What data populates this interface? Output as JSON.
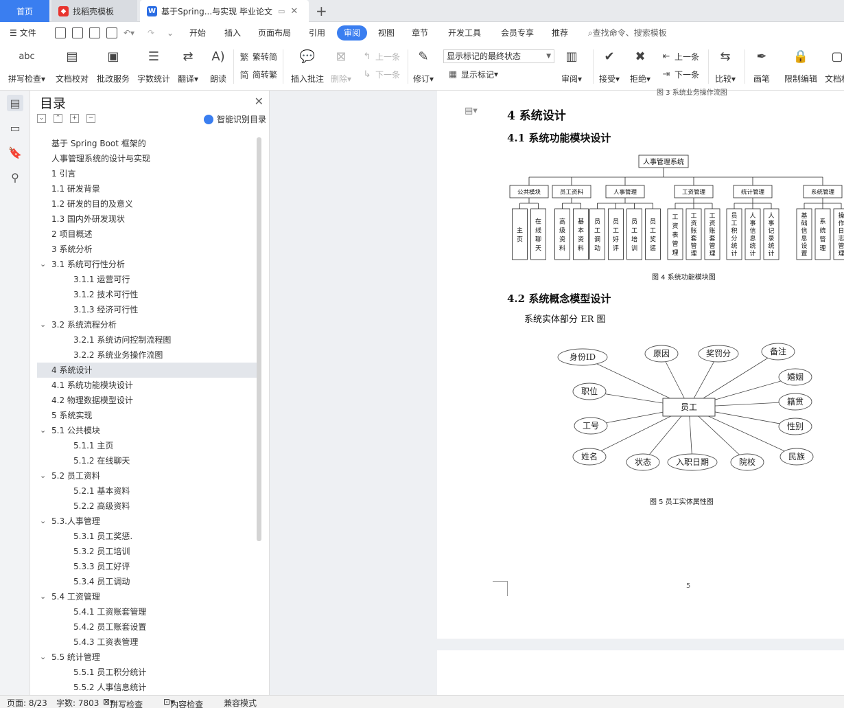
{
  "tabs": {
    "home": "首页",
    "template": "找稻壳模板",
    "document": "基于Spring...与实现 毕业论文"
  },
  "menu": {
    "file": "文件",
    "items": [
      "开始",
      "插入",
      "页面布局",
      "引用",
      "审阅",
      "视图",
      "章节",
      "开发工具",
      "会员专享",
      "推荐"
    ],
    "active": "审阅",
    "search": "查找命令、搜索模板"
  },
  "ribbon": {
    "spell": "拼写检查",
    "proofread": "文档校对",
    "review_service": "批改服务",
    "word_count": "字数统计",
    "translate": "翻译",
    "read_aloud": "朗读",
    "to_simplified": "繁转简",
    "to_traditional": "简转繁",
    "insert_comment": "插入批注",
    "delete": "删除",
    "prev_comment": "上一条",
    "next_comment": "下一条",
    "track_changes": "修订",
    "markup_state": "显示标记的最终状态",
    "show_markup": "显示标记",
    "review": "审阅",
    "accept": "接受",
    "reject": "拒绝",
    "prev": "上一条",
    "next": "下一条",
    "compare": "比较",
    "ink": "画笔",
    "restrict": "限制编辑",
    "doc_rights": "文档权"
  },
  "toc": {
    "title": "目录",
    "smart": "智能识别目录",
    "items": [
      {
        "text": "基于 Spring Boot 框架的",
        "level": 0
      },
      {
        "text": "人事管理系统的设计与实现",
        "level": 0
      },
      {
        "text": "1 引言",
        "level": 0
      },
      {
        "text": "1.1 研发背景",
        "level": 0
      },
      {
        "text": "1.2 研发的目的及意义",
        "level": 0
      },
      {
        "text": "1.3 国内外研发现状",
        "level": 0
      },
      {
        "text": "2 项目概述",
        "level": 0
      },
      {
        "text": "3 系统分析",
        "level": 0
      },
      {
        "text": "3.1 系统可行性分析",
        "level": 0,
        "chev": true
      },
      {
        "text": "3.1.1 运营可行",
        "level": 1
      },
      {
        "text": "3.1.2 技术可行性",
        "level": 1
      },
      {
        "text": "3.1.3 经济可行性",
        "level": 1
      },
      {
        "text": "3.2 系统流程分析",
        "level": 0,
        "chev": true
      },
      {
        "text": "3.2.1 系统访问控制流程图",
        "level": 1
      },
      {
        "text": "3.2.2 系统业务操作流图",
        "level": 1
      },
      {
        "text": "4 系统设计",
        "level": 0,
        "highlight": true
      },
      {
        "text": "4.1 系统功能模块设计",
        "level": 0
      },
      {
        "text": "4.2 物理数据模型设计",
        "level": 0
      },
      {
        "text": "5 系统实现",
        "level": 0
      },
      {
        "text": "5.1  公共模块",
        "level": 0,
        "chev": true
      },
      {
        "text": "5.1.1 主页",
        "level": 1
      },
      {
        "text": "5.1.2 在线聊天",
        "level": 1
      },
      {
        "text": "5.2  员工资料",
        "level": 0,
        "chev": true
      },
      {
        "text": "5.2.1 基本资料",
        "level": 1
      },
      {
        "text": "5.2.2  高级资料",
        "level": 1
      },
      {
        "text": "5.3.人事管理",
        "level": 0,
        "chev": true
      },
      {
        "text": "5.3.1 员工奖惩.",
        "level": 1
      },
      {
        "text": "5.3.2 员工培训",
        "level": 1
      },
      {
        "text": "5.3.3 员工好评",
        "level": 1
      },
      {
        "text": "5.3.4 员工调动",
        "level": 1
      },
      {
        "text": "5.4 工资管理",
        "level": 0,
        "chev": true
      },
      {
        "text": "5.4.1 工资账套管理",
        "level": 1
      },
      {
        "text": "5.4.2 员工账套设置",
        "level": 1
      },
      {
        "text": "5.4.3 工资表管理",
        "level": 1
      },
      {
        "text": "5.5 统计管理",
        "level": 0,
        "chev": true
      },
      {
        "text": "5.5.1 员工积分统计",
        "level": 1
      },
      {
        "text": "5.5.2 人事信息统计",
        "level": 1
      }
    ]
  },
  "document": {
    "prev_caption": "图 3  系统业务操作流图",
    "h1": "4 系统设计",
    "h2_1": "4.1 系统功能模块设计",
    "h2_2": "4.2 系统概念模型设计",
    "body": "系统实体部分 ER 图",
    "fig4_caption": "图 4 系统功能模块图",
    "fig5_caption": "图 5  员工实体属性图",
    "page_number": "5",
    "module_chart": {
      "root": "人事管理系统",
      "groups": [
        {
          "name": "公共模块",
          "children": [
            "主页",
            "在线聊天"
          ]
        },
        {
          "name": "员工资料",
          "children": [
            "高级资料",
            "基本资料"
          ]
        },
        {
          "name": "人事管理",
          "children": [
            "员工调动",
            "员工好评",
            "员工培训",
            "员工奖惩"
          ]
        },
        {
          "name": "工资管理",
          "children": [
            "工资表管理",
            "工资账套管理",
            "工资账套管理"
          ]
        },
        {
          "name": "统计管理",
          "children": [
            "员工积分统计",
            "人事信息统计",
            "人事记录统计"
          ]
        },
        {
          "name": "系统管理",
          "children": [
            "基础信息设置",
            "系统管理",
            "操作日志管理"
          ]
        }
      ]
    },
    "er": {
      "entity": "员工",
      "attributes": [
        "身份ID",
        "原因",
        "奖罚分",
        "备注",
        "婚姻",
        "籍贯",
        "性别",
        "民族",
        "院校",
        "入职日期",
        "状态",
        "姓名",
        "工号",
        "职位"
      ]
    }
  },
  "status": {
    "page": "页面: 8/23",
    "words": "字数: 7803",
    "spell": "拼写检查",
    "content": "内容检查",
    "compat": "兼容模式"
  }
}
